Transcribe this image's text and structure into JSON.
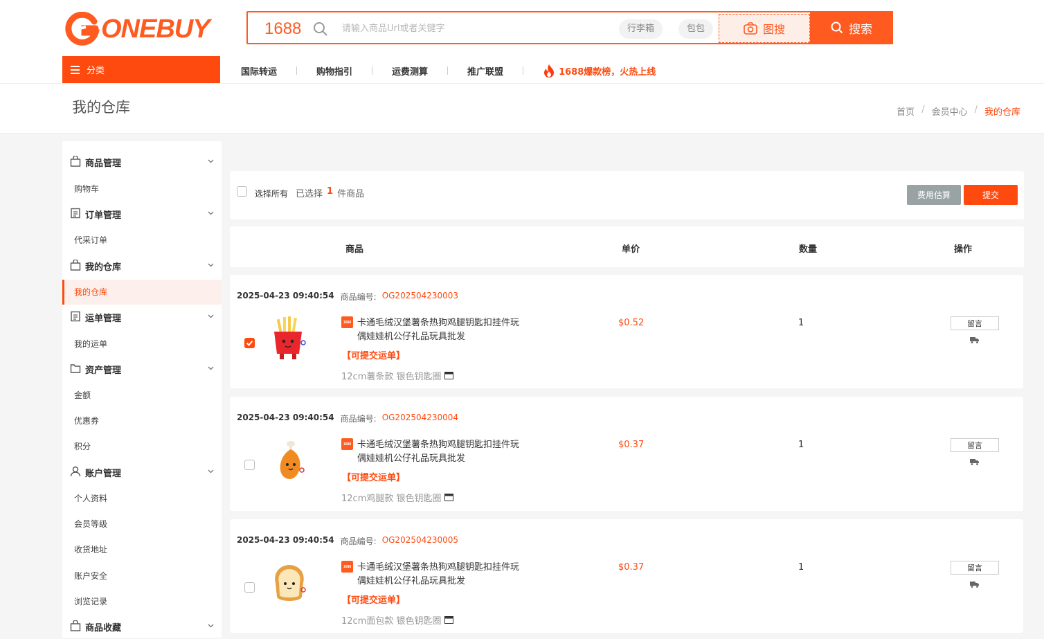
{
  "header": {
    "logo_text": "ONEBUY",
    "search_brand": "1688",
    "search_placeholder": "请输入商品Url或者关键字",
    "tags": [
      "行李箱",
      "包包"
    ],
    "image_search_label": "图搜",
    "search_button_label": "搜索",
    "category_button_label": "分类",
    "nav": [
      "国际转运",
      "购物指引",
      "运费测算",
      "推广联盟"
    ],
    "hot_label": "1688爆款榜，火热上线"
  },
  "page": {
    "title": "我的仓库",
    "breadcrumbs": [
      "首页",
      "会员中心",
      "我的仓库"
    ]
  },
  "sidebar": [
    {
      "group": "商品管理",
      "icon": "bag-icon",
      "items": [
        "购物车"
      ]
    },
    {
      "group": "订单管理",
      "icon": "document-icon",
      "items": [
        "代采订单"
      ]
    },
    {
      "group": "我的仓库",
      "icon": "bag-icon",
      "items": [
        "我的仓库"
      ],
      "active_item": "我的仓库"
    },
    {
      "group": "运单管理",
      "icon": "document-icon",
      "items": [
        "我的运单"
      ]
    },
    {
      "group": "资产管理",
      "icon": "folder-icon",
      "items": [
        "金额",
        "优惠券",
        "积分"
      ]
    },
    {
      "group": "账户管理",
      "icon": "user-icon",
      "items": [
        "个人资料",
        "会员等级",
        "收货地址",
        "账户安全",
        "浏览记录"
      ]
    },
    {
      "group": "商品收藏",
      "icon": "bag-icon",
      "items": []
    }
  ],
  "toolbar": {
    "select_all_label": "选择所有",
    "selected_prefix": "已选择",
    "selected_count": "1",
    "selected_suffix": "件商品",
    "estimate_button": "费用估算",
    "submit_button": "提交"
  },
  "table": {
    "headers": [
      "商品",
      "单价",
      "数量",
      "操作"
    ],
    "rows": [
      {
        "datetime": "2025-04-23 09:40:54",
        "code_label": "商品编号:",
        "code": "OG202504230003",
        "source_badge": "1688",
        "name": "卡通毛绒汉堡薯条热狗鸡腿钥匙扣挂件玩偶娃娃机公仔礼品玩具批发",
        "status": "【可提交运单】",
        "spec": "12cm薯条款 银色钥匙圈",
        "price": "$0.52",
        "quantity": "1",
        "message_button": "留言",
        "checked": true,
        "thumb": "fries"
      },
      {
        "datetime": "2025-04-23 09:40:54",
        "code_label": "商品编号:",
        "code": "OG202504230004",
        "source_badge": "1688",
        "name": "卡通毛绒汉堡薯条热狗鸡腿钥匙扣挂件玩偶娃娃机公仔礼品玩具批发",
        "status": "【可提交运单】",
        "spec": "12cm鸡腿款 银色钥匙圈",
        "price": "$0.37",
        "quantity": "1",
        "message_button": "留言",
        "checked": false,
        "thumb": "drumstick"
      },
      {
        "datetime": "2025-04-23 09:40:54",
        "code_label": "商品编号:",
        "code": "OG202504230005",
        "source_badge": "1688",
        "name": "卡通毛绒汉堡薯条热狗鸡腿钥匙扣挂件玩偶娃娃机公仔礼品玩具批发",
        "status": "【可提交运单】",
        "spec": "12cm面包款 银色钥匙圈",
        "price": "$0.37",
        "quantity": "1",
        "message_button": "留言",
        "checked": false,
        "thumb": "bread"
      }
    ]
  },
  "colors": {
    "accent": "#ff4a0f",
    "gray_button": "#99a3a4"
  }
}
